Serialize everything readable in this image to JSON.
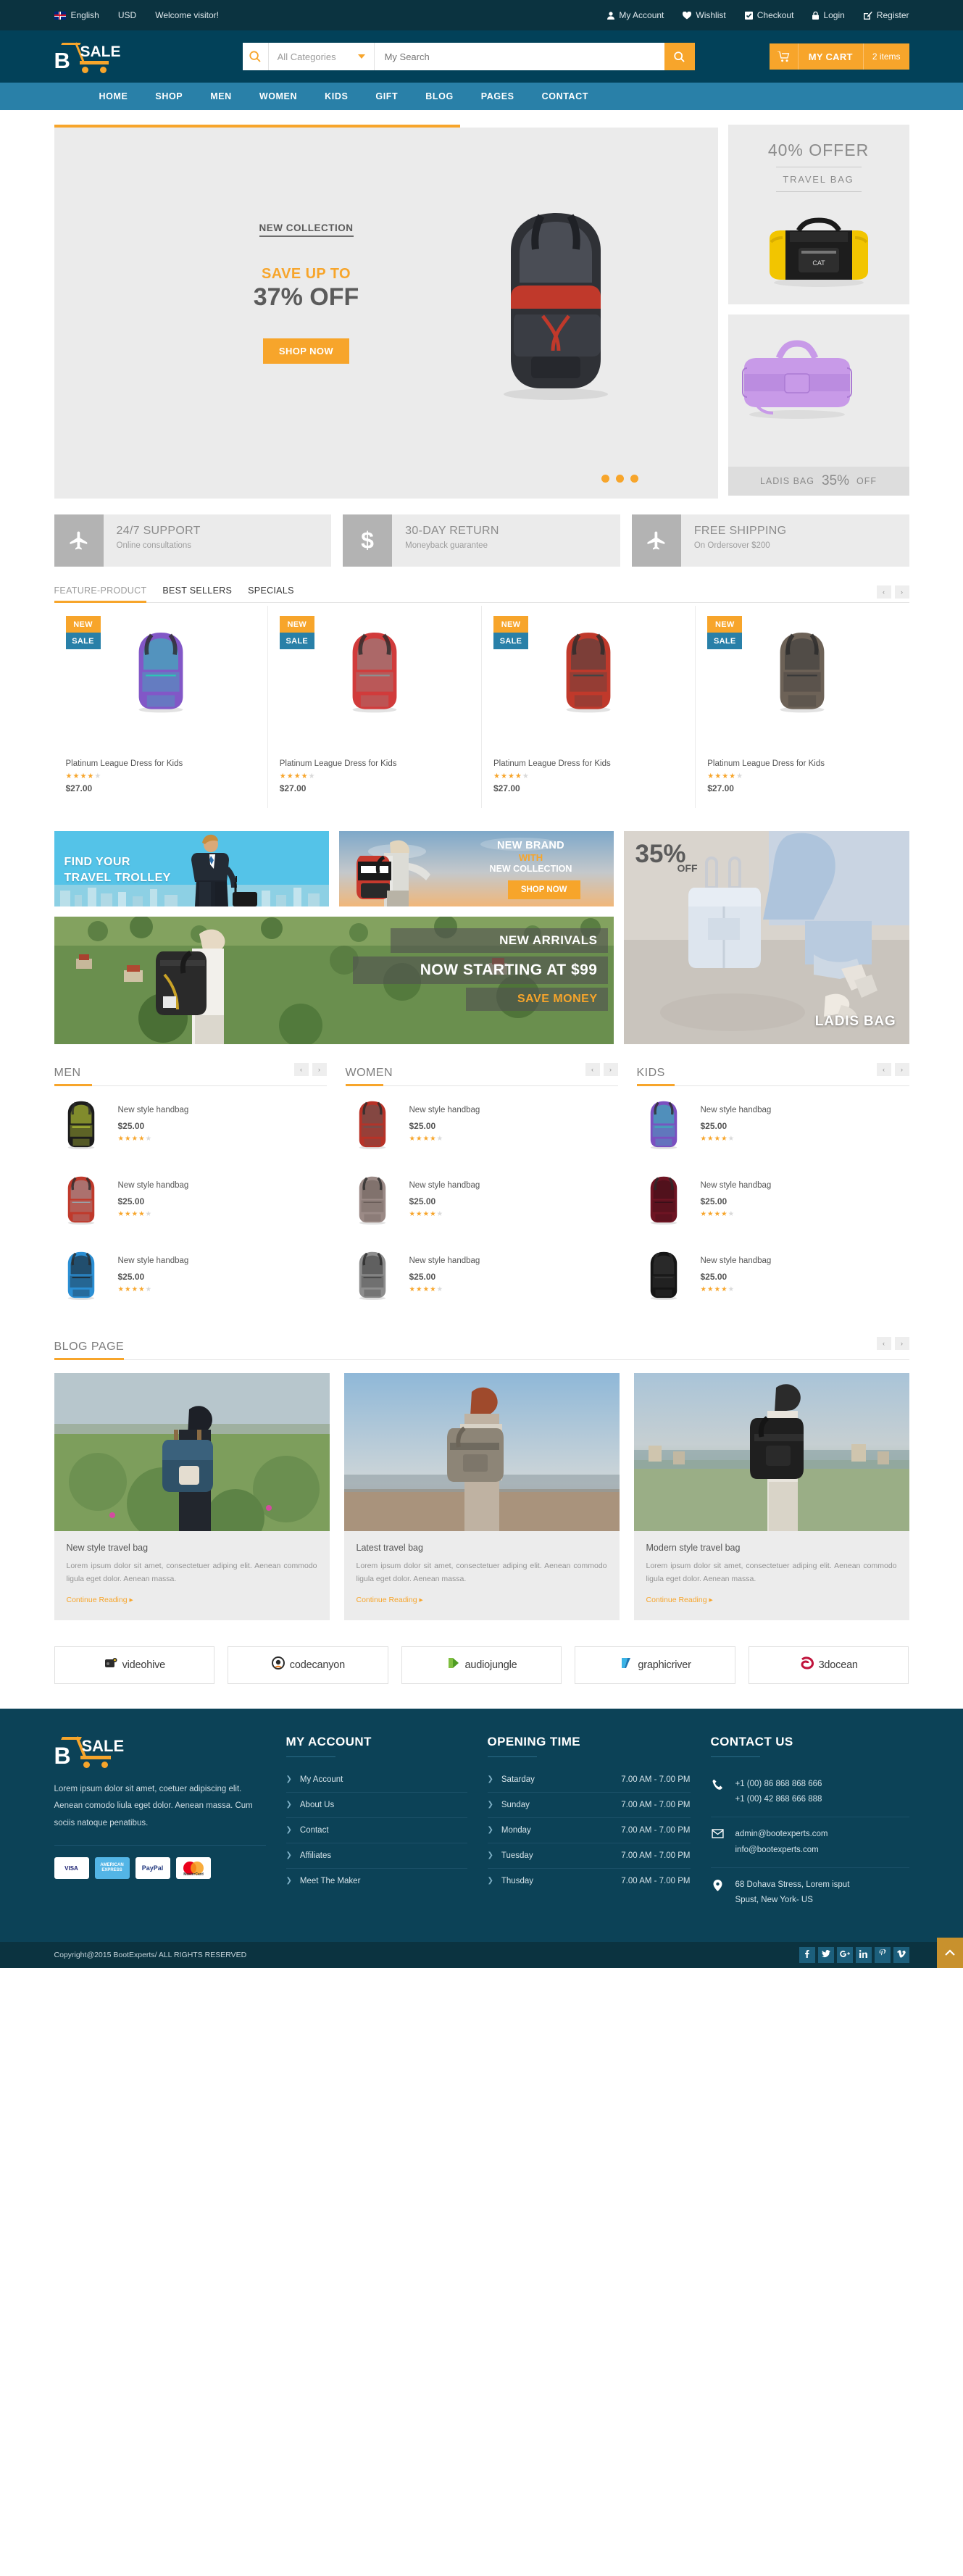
{
  "topbar": {
    "language": "English",
    "currency": "USD",
    "welcome": "Welcome visitor!",
    "links": [
      {
        "label": "My Account",
        "icon": "user-icon"
      },
      {
        "label": "Wishlist",
        "icon": "heart-icon"
      },
      {
        "label": "Checkout",
        "icon": "checkbox-icon"
      },
      {
        "label": "Login",
        "icon": "lock-icon"
      },
      {
        "label": "Register",
        "icon": "edit-icon"
      }
    ]
  },
  "header": {
    "logo_b": "B",
    "logo_sale": "SALE",
    "search": {
      "category": "All Categories",
      "placeholder": "My Search",
      "value": ""
    },
    "cart": {
      "label": "MY CART",
      "count": "2 items"
    }
  },
  "nav": {
    "items": [
      "HOME",
      "SHOP",
      "MEN",
      "WOMEN",
      "KIDS",
      "GIFT",
      "BLOG",
      "PAGES",
      "CONTACT"
    ]
  },
  "hero": {
    "eyebrow": "NEW COLLECTION",
    "save_text": "SAVE UP TO",
    "discount": "37% OFF",
    "cta": "SHOP NOW",
    "dots": 3,
    "side_top": {
      "title": "40% OFFER",
      "subtitle": "TRAVEL BAG"
    },
    "side_bottom": {
      "label": "LADIS BAG",
      "percent": "35%",
      "off": "OFF"
    }
  },
  "services": [
    {
      "icon": "plane-icon",
      "title": "24/7 SUPPORT",
      "subtitle": "Online consultations"
    },
    {
      "icon": "dollar-icon",
      "title": "30-DAY RETURN",
      "subtitle": "Moneyback guarantee"
    },
    {
      "icon": "plane-icon",
      "title": "FREE SHIPPING",
      "subtitle": "On Ordersover $200"
    }
  ],
  "product_tabs": {
    "tabs": [
      {
        "label": "FEATURE-PRODUCT",
        "active": true
      },
      {
        "label": "BEST SELLERS",
        "active": false
      },
      {
        "label": "SPECIALS",
        "active": false
      }
    ],
    "arrow_prev": "‹",
    "arrow_next": "›"
  },
  "featured_products": [
    {
      "badge_new": "NEW",
      "badge_sale": "SALE",
      "title": "Platinum League Dress for Kids",
      "price": "$27.00",
      "rating": 4,
      "color": "#8257c7",
      "accent": "#2ec4b6"
    },
    {
      "badge_new": "NEW",
      "badge_sale": "SALE",
      "title": "Platinum League Dress for Kids",
      "price": "$27.00",
      "rating": 4,
      "color": "#d13b3b",
      "accent": "#8e8e8e"
    },
    {
      "badge_new": "NEW",
      "badge_sale": "SALE",
      "title": "Platinum League Dress for Kids",
      "price": "$27.00",
      "rating": 4,
      "color": "#c0392b",
      "accent": "#444444"
    },
    {
      "badge_new": "NEW",
      "badge_sale": "SALE",
      "title": "Platinum League Dress for Kids",
      "price": "$27.00",
      "rating": 4,
      "color": "#6d6257",
      "accent": "#3a3a3a"
    }
  ],
  "promos": {
    "trolley": {
      "line1": "FIND YOUR",
      "line2": "TRAVEL TROLLEY"
    },
    "brand": {
      "line1": "NEW BRAND",
      "line2": "WITH",
      "line3": "NEW COLLECTION",
      "cta": "SHOP NOW"
    },
    "arrivals": {
      "line1": "NEW ARRIVALS",
      "line2": "NOW STARTING AT $99",
      "line3": "SAVE MONEY"
    },
    "ladis": {
      "percent": "35%",
      "off": "OFF",
      "label": "LADIS BAG"
    }
  },
  "categories": [
    {
      "title": "MEN",
      "items": [
        {
          "name": "New style handbag",
          "price": "$25.00",
          "rating": 4,
          "color": "#1c1c1c",
          "accent": "#d6e83a"
        },
        {
          "name": "New style handbag",
          "price": "$25.00",
          "rating": 4,
          "color": "#c0392b",
          "accent": "#9aa0a6"
        },
        {
          "name": "New style handbag",
          "price": "$25.00",
          "rating": 4,
          "color": "#2b8fd4",
          "accent": "#1a1a1a"
        }
      ]
    },
    {
      "title": "WOMEN",
      "items": [
        {
          "name": "New style handbag",
          "price": "$25.00",
          "rating": 4,
          "color": "#b83227",
          "accent": "#5a5a5a"
        },
        {
          "name": "New style handbag",
          "price": "$25.00",
          "rating": 4,
          "color": "#9b8a86",
          "accent": "#6b5e5a"
        },
        {
          "name": "New style handbag",
          "price": "$25.00",
          "rating": 4,
          "color": "#8e8e8e",
          "accent": "#3a3a3a"
        }
      ]
    },
    {
      "title": "KIDS",
      "items": [
        {
          "name": "New style handbag",
          "price": "$25.00",
          "rating": 4,
          "color": "#7b4fc0",
          "accent": "#2ec4b6"
        },
        {
          "name": "New style handbag",
          "price": "$25.00",
          "rating": 4,
          "color": "#6e1423",
          "accent": "#3a0f18"
        },
        {
          "name": "New style handbag",
          "price": "$25.00",
          "rating": 4,
          "color": "#151515",
          "accent": "#3a3a3a"
        }
      ]
    }
  ],
  "blog": {
    "title": "BLOG PAGE",
    "posts": [
      {
        "title": "New style travel bag",
        "excerpt": "Lorem ipsum dolor sit amet, consectetuer adiping elit. Aenean commodo ligula eget dolor. Aenean massa.",
        "more": "Continue Reading ▸"
      },
      {
        "title": "Latest travel bag",
        "excerpt": "Lorem ipsum dolor sit amet, consectetuer adiping elit. Aenean commodo ligula eget dolor. Aenean massa.",
        "more": "Continue Reading ▸"
      },
      {
        "title": "Modern style travel bag",
        "excerpt": "Lorem ipsum dolor sit amet, consectetuer adiping elit. Aenean commodo ligula eget dolor. Aenean massa.",
        "more": "Continue Reading ▸"
      }
    ]
  },
  "brands": [
    {
      "name": "videohive",
      "color": "#3c3c3c"
    },
    {
      "name": "codecanyon",
      "color": "#3c3c3c"
    },
    {
      "name": "audiojungle",
      "color": "#3c3c3c"
    },
    {
      "name": "graphicriver",
      "color": "#3c3c3c"
    },
    {
      "name": "3docean",
      "color": "#3c3c3c"
    }
  ],
  "footer": {
    "about": "Lorem ipsum dolor sit amet, coetuer adipiscing elit. Aenean comodo liula eget dolor. Aenean massa. Cum sociis natoque penatibus.",
    "payments": [
      "VISA",
      "AMERICAN EXPRESS",
      "PayPal",
      "MasterCard"
    ],
    "my_account": {
      "title": "MY ACCOUNT",
      "items": [
        "My Account",
        "About Us",
        "Contact",
        "Affiliates",
        "Meet The Maker"
      ]
    },
    "opening_time": {
      "title": "OPENING TIME",
      "rows": [
        {
          "day": "Satarday",
          "hours": "7.00 AM - 7.00 PM"
        },
        {
          "day": "Sunday",
          "hours": "7.00 AM - 7.00 PM"
        },
        {
          "day": "Monday",
          "hours": "7.00 AM - 7.00 PM"
        },
        {
          "day": "Tuesday",
          "hours": "7.00 AM - 7.00 PM"
        },
        {
          "day": "Thusday",
          "hours": "7.00 AM - 7.00 PM"
        }
      ]
    },
    "contact": {
      "title": "CONTACT US",
      "phone1": "+1 (00) 86 868 868 666",
      "phone2": "+1 (00) 42 868 666 888",
      "email1": "admin@bootexperts.com",
      "email2": "info@bootexperts.com",
      "address1": "68 Dohava Stress, Lorem isput",
      "address2": "Spust, New York- US"
    }
  },
  "bottom": {
    "copyright": "Copyright@2015 BootExperts/ ALL RIGHTS RESERVED",
    "socials": [
      "facebook-icon",
      "twitter-icon",
      "google-plus-icon",
      "linkedin-icon",
      "pinterest-icon",
      "vimeo-icon"
    ],
    "to_top": "▲"
  },
  "colors": {
    "topbar": "#0b3340",
    "header": "#024159",
    "nav": "#2980a8",
    "accent": "#f7a52b",
    "secondary": "#2980a8",
    "footer": "#0c4257"
  }
}
